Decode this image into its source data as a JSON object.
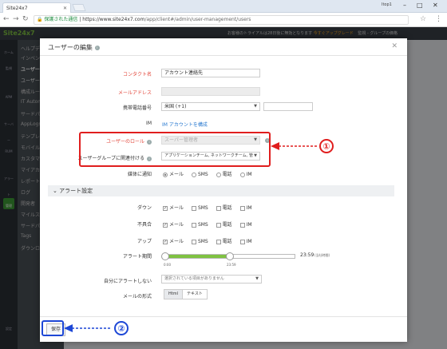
{
  "browser": {
    "tab_title": "Site24x7",
    "user": "Itop1",
    "secure_label": "保護された通信",
    "url_host": "https://www.site24x7.com",
    "url_path": "/app/client#/admin/user-management/users"
  },
  "app": {
    "logo": "Site24x7",
    "trial_notice": "お客様のトライアルは28日後に無効となります",
    "upgrade_label": "今すぐアップグレード",
    "monitor_group": "監視 - グループの価格"
  },
  "side_menu": [
    "ヘルプデスク",
    "インベントリ",
    "ユーザー",
    "ユーザー",
    "構成ルール",
    "IT Automation",
    "サードパーティ",
    "AppLogs",
    "テンプレート",
    "モバイルカスタマイズ",
    "カスタマイズ",
    "マイアカウント",
    "レポート",
    "ログ",
    "開発者",
    "マイルストーン",
    "サードパーティ",
    "Tags",
    "ダウンロード"
  ],
  "left_nav": [
    "ホーム",
    "監視",
    "",
    "APM",
    "",
    "サーバー",
    "",
    "RUM",
    "",
    "アラート",
    "",
    "管理",
    "設定"
  ],
  "modal": {
    "title": "ユーザーの編集",
    "fields": {
      "contact_label": "コンタクト名",
      "contact_value": "アカウント連絡先",
      "email_label": "メールアドレス",
      "mobile_label": "携帯電話番号",
      "country_value": "米国 (+1)",
      "im_label": "IM",
      "im_link": "IM アカウントを構成",
      "role_label": "ユーザーのロール",
      "role_value": "スーパー管理者",
      "group_label": "ユーザーグループに関連付ける",
      "group_value": "アプリケーションチーム, ネットワークチーム, 管",
      "notify_label": "媒体に通知"
    },
    "notify_options": [
      "メール",
      "SMS",
      "電話",
      "IM"
    ],
    "alert_section": "アラート設定",
    "alert_rows": [
      {
        "label": "ダウン",
        "options": [
          "メール",
          "SMS",
          "電話",
          "IM"
        ]
      },
      {
        "label": "不具合",
        "options": [
          "メール",
          "SMS",
          "電話",
          "IM"
        ]
      },
      {
        "label": "アップ",
        "options": [
          "メール",
          "SMS",
          "電話",
          "IM"
        ]
      }
    ],
    "alert_period_label": "アラート期間",
    "alert_period_end": "23:59",
    "alert_period_tz": "(当社時間)",
    "slider_ticks": [
      "0:00",
      "23:59"
    ],
    "slider_fraction": 1.0,
    "dnd_label": "自分にアラートしない",
    "dnd_placeholder": "選択されている項目がありません",
    "mail_format_label": "メールの形式",
    "mail_formats": [
      "Html",
      "テキスト"
    ],
    "save_label": "保存"
  },
  "annotations": {
    "one": "①",
    "two": "②",
    "red": "#e01e1e",
    "blue": "#1d47d6"
  }
}
